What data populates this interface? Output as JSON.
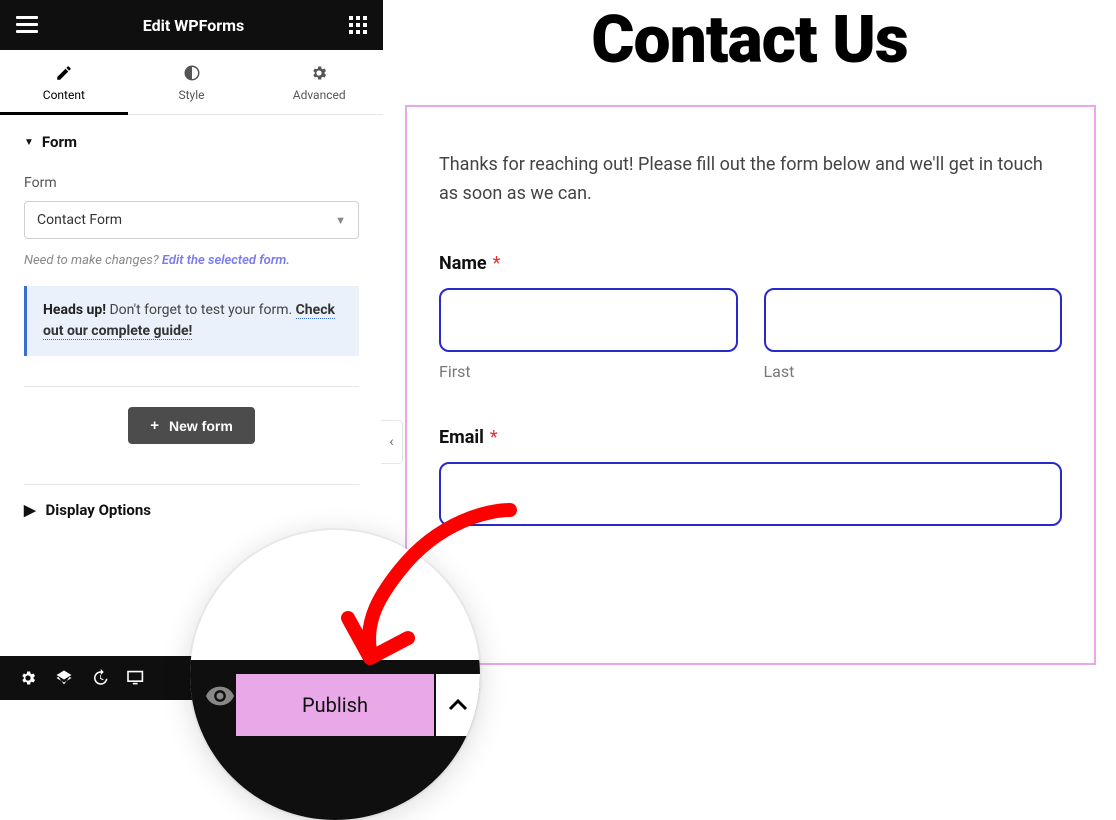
{
  "sidebar": {
    "title": "Edit WPForms",
    "tabs": [
      {
        "label": "Content"
      },
      {
        "label": "Style"
      },
      {
        "label": "Advanced"
      }
    ],
    "section_form": "Form",
    "form_label": "Form",
    "form_select_value": "Contact Form",
    "helper_prefix": "Need to make changes? ",
    "helper_link": "Edit the selected form.",
    "callout_strong": "Heads up!",
    "callout_text": " Don't forget to test your form. ",
    "callout_link": "Check out our complete guide!",
    "new_form_btn": "New form",
    "display_options": "Display Options"
  },
  "publish": {
    "label": "Publish"
  },
  "preview": {
    "page_title": "Contact Us",
    "intro": "Thanks for reaching out! Please fill out the form below and we'll get in touch as soon as we can.",
    "name_label": "Name",
    "email_label": "Email",
    "required_marker": "*",
    "first_sub": "First",
    "last_sub": "Last"
  }
}
